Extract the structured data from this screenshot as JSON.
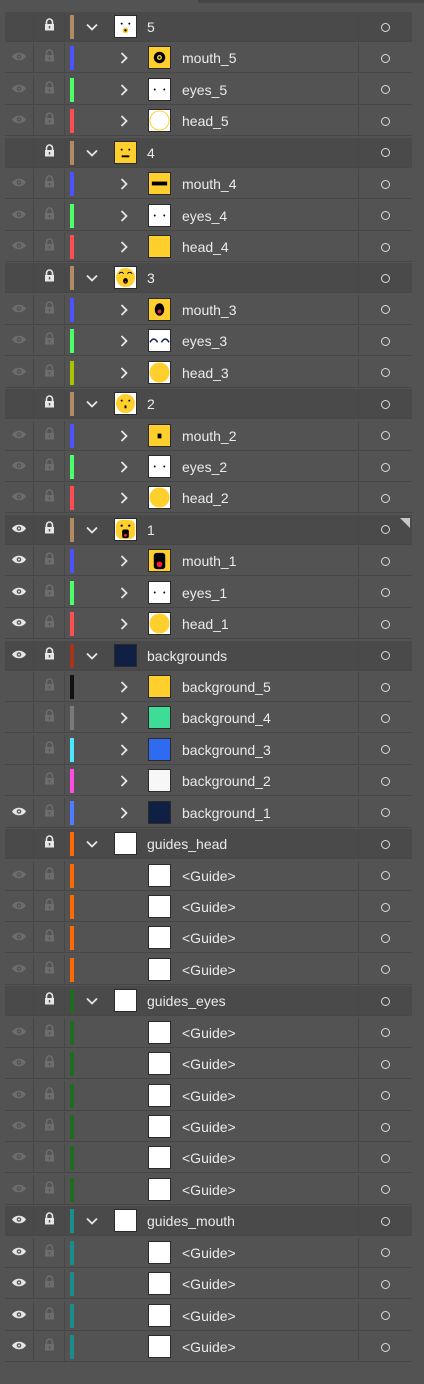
{
  "colors": {
    "panel_bg": "#535353",
    "group_bg": "#4a4a4a",
    "visible_icon": "#e6e6e6",
    "hidden_icon": "#6d6d6d",
    "lock_icon": "#e6e6e6"
  },
  "layers": [
    {
      "kind": "group",
      "name": "5",
      "eye": "hidden",
      "lock": "visible",
      "bar": "#b08a62",
      "thumb": "face5"
    },
    {
      "kind": "item",
      "name": "mouth_5",
      "eye": "faded",
      "lock": "faded",
      "bar": "#4d52ff",
      "thumb": "mouth5"
    },
    {
      "kind": "item",
      "name": "eyes_5",
      "eye": "faded",
      "lock": "faded",
      "bar": "#4dff6a",
      "thumb": "eyes"
    },
    {
      "kind": "item",
      "name": "head_5",
      "eye": "faded",
      "lock": "faded",
      "bar": "#ff4d52",
      "thumb": "head5"
    },
    {
      "kind": "group",
      "name": "4",
      "eye": "hidden",
      "lock": "visible",
      "bar": "#b08a62",
      "thumb": "face4"
    },
    {
      "kind": "item",
      "name": "mouth_4",
      "eye": "faded",
      "lock": "faded",
      "bar": "#4d52ff",
      "thumb": "mouth4"
    },
    {
      "kind": "item",
      "name": "eyes_4",
      "eye": "faded",
      "lock": "faded",
      "bar": "#4dff6a",
      "thumb": "eyes"
    },
    {
      "kind": "item",
      "name": "head_4",
      "eye": "faded",
      "lock": "faded",
      "bar": "#ff4d52",
      "thumb": "head4"
    },
    {
      "kind": "group",
      "name": "3",
      "eye": "hidden",
      "lock": "visible",
      "bar": "#b08a62",
      "thumb": "face3"
    },
    {
      "kind": "item",
      "name": "mouth_3",
      "eye": "faded",
      "lock": "faded",
      "bar": "#4d52ff",
      "thumb": "mouth3"
    },
    {
      "kind": "item",
      "name": "eyes_3",
      "eye": "faded",
      "lock": "faded",
      "bar": "#4dff6a",
      "thumb": "eyes3"
    },
    {
      "kind": "item",
      "name": "head_3",
      "eye": "faded",
      "lock": "faded",
      "bar": "#a8c400",
      "thumb": "headcircle"
    },
    {
      "kind": "group",
      "name": "2",
      "eye": "hidden",
      "lock": "visible",
      "bar": "#b08a62",
      "thumb": "face2"
    },
    {
      "kind": "item",
      "name": "mouth_2",
      "eye": "faded",
      "lock": "faded",
      "bar": "#4d52ff",
      "thumb": "mouth2"
    },
    {
      "kind": "item",
      "name": "eyes_2",
      "eye": "faded",
      "lock": "faded",
      "bar": "#4dff6a",
      "thumb": "eyes"
    },
    {
      "kind": "item",
      "name": "head_2",
      "eye": "faded",
      "lock": "faded",
      "bar": "#ff4d52",
      "thumb": "headcircle"
    },
    {
      "kind": "group",
      "name": "1",
      "eye": "visible",
      "lock": "visible",
      "bar": "#b08a62",
      "thumb": "face1"
    },
    {
      "kind": "item",
      "name": "mouth_1",
      "eye": "visible",
      "lock": "faded",
      "bar": "#4d52ff",
      "thumb": "mouth1"
    },
    {
      "kind": "item",
      "name": "eyes_1",
      "eye": "visible",
      "lock": "faded",
      "bar": "#4dff6a",
      "thumb": "eyes"
    },
    {
      "kind": "item",
      "name": "head_1",
      "eye": "visible",
      "lock": "faded",
      "bar": "#ff4d52",
      "thumb": "headcircle"
    },
    {
      "kind": "group",
      "name": "backgrounds",
      "eye": "visible",
      "lock": "visible",
      "bar": "#a4361a",
      "thumb": "navy"
    },
    {
      "kind": "item",
      "name": "background_5",
      "eye": "none",
      "lock": "faded",
      "bar": "#111111",
      "thumb": "bg5"
    },
    {
      "kind": "item",
      "name": "background_4",
      "eye": "none",
      "lock": "faded",
      "bar": "#7a7a7a",
      "thumb": "bg4"
    },
    {
      "kind": "item",
      "name": "background_3",
      "eye": "none",
      "lock": "faded",
      "bar": "#4de8ff",
      "thumb": "bg3"
    },
    {
      "kind": "item",
      "name": "background_2",
      "eye": "none",
      "lock": "faded",
      "bar": "#ff4de0",
      "thumb": "bg2"
    },
    {
      "kind": "item",
      "name": "background_1",
      "eye": "visible",
      "lock": "faded",
      "bar": "#4d7cff",
      "thumb": "bg1"
    },
    {
      "kind": "group",
      "name": "guides_head",
      "eye": "hidden",
      "lock": "visible",
      "bar": "#ff6a00",
      "thumb": "white"
    },
    {
      "kind": "guide",
      "name": "<Guide>",
      "eye": "faded",
      "lock": "faded",
      "bar": "#ff6a00",
      "thumb": "white"
    },
    {
      "kind": "guide",
      "name": "<Guide>",
      "eye": "faded",
      "lock": "faded",
      "bar": "#ff6a00",
      "thumb": "white"
    },
    {
      "kind": "guide",
      "name": "<Guide>",
      "eye": "faded",
      "lock": "faded",
      "bar": "#ff6a00",
      "thumb": "white"
    },
    {
      "kind": "guide",
      "name": "<Guide>",
      "eye": "faded",
      "lock": "faded",
      "bar": "#ff6a00",
      "thumb": "white"
    },
    {
      "kind": "group",
      "name": "guides_eyes",
      "eye": "hidden",
      "lock": "visible",
      "bar": "#1f6b1f",
      "thumb": "white"
    },
    {
      "kind": "guide",
      "name": "<Guide>",
      "eye": "faded",
      "lock": "faded",
      "bar": "#1f6b1f",
      "thumb": "white"
    },
    {
      "kind": "guide",
      "name": "<Guide>",
      "eye": "faded",
      "lock": "faded",
      "bar": "#1f6b1f",
      "thumb": "white"
    },
    {
      "kind": "guide",
      "name": "<Guide>",
      "eye": "faded",
      "lock": "faded",
      "bar": "#1f6b1f",
      "thumb": "white"
    },
    {
      "kind": "guide",
      "name": "<Guide>",
      "eye": "faded",
      "lock": "faded",
      "bar": "#1f6b1f",
      "thumb": "white"
    },
    {
      "kind": "guide",
      "name": "<Guide>",
      "eye": "faded",
      "lock": "faded",
      "bar": "#1f6b1f",
      "thumb": "white"
    },
    {
      "kind": "guide",
      "name": "<Guide>",
      "eye": "faded",
      "lock": "faded",
      "bar": "#1f6b1f",
      "thumb": "white"
    },
    {
      "kind": "group",
      "name": "guides_mouth",
      "eye": "visible",
      "lock": "visible",
      "bar": "#1a8c8c",
      "thumb": "white"
    },
    {
      "kind": "guide",
      "name": "<Guide>",
      "eye": "visible",
      "lock": "faded",
      "bar": "#1a8c8c",
      "thumb": "white"
    },
    {
      "kind": "guide",
      "name": "<Guide>",
      "eye": "visible",
      "lock": "faded",
      "bar": "#1a8c8c",
      "thumb": "white"
    },
    {
      "kind": "guide",
      "name": "<Guide>",
      "eye": "visible",
      "lock": "faded",
      "bar": "#1a8c8c",
      "thumb": "white"
    },
    {
      "kind": "guide",
      "name": "<Guide>",
      "eye": "visible",
      "lock": "faded",
      "bar": "#1a8c8c",
      "thumb": "white"
    }
  ]
}
